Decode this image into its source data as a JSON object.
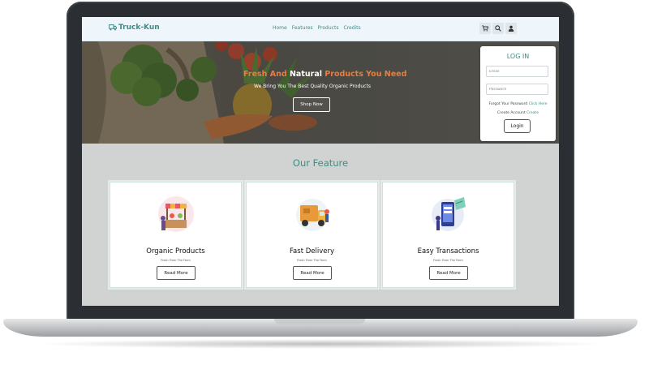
{
  "brand": {
    "name": "Truck-Kun"
  },
  "nav": {
    "links": [
      "Home",
      "Features",
      "Products",
      "Credits"
    ],
    "icons": [
      "cart-icon",
      "search-icon",
      "user-icon"
    ]
  },
  "hero": {
    "title_part1": "Fresh And ",
    "title_part2": "Natural",
    "title_part3": " Products You Need",
    "subtitle": "We Bring You The Best Quality Organic Products",
    "cta": "Shop Now"
  },
  "login": {
    "title": "LOG IN",
    "email_placeholder": "Email",
    "password_placeholder": "Password",
    "forgot_text": "Forgot Your Password ",
    "forgot_link": "Click Here",
    "create_text": "Create Account ",
    "create_link": "Create",
    "button": "Login"
  },
  "features": {
    "title": "Our Feature",
    "items": [
      {
        "name": "Organic Products",
        "subtitle": "Fresh From The Farm",
        "button": "Read More",
        "icon": "market-stall-icon"
      },
      {
        "name": "Fast Delivery",
        "subtitle": "Fresh From The Farm",
        "button": "Read More",
        "icon": "delivery-truck-icon"
      },
      {
        "name": "Easy Transactions",
        "subtitle": "Fresh From The Farm",
        "button": "Read More",
        "icon": "mobile-payment-icon"
      }
    ]
  },
  "colors": {
    "accent": "#3e8c85",
    "hero_highlight": "#f07a3a",
    "navbar_bg": "#eef5fb",
    "section_bg": "#d1d3d2"
  }
}
